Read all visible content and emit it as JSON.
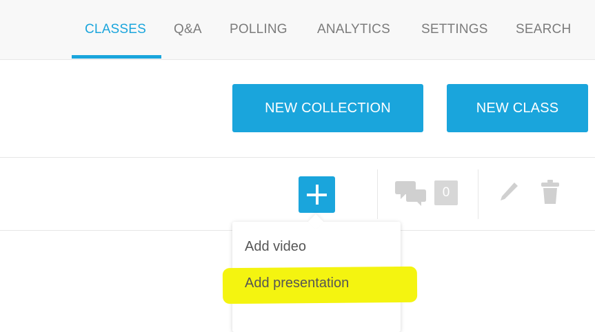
{
  "topnav": {
    "tabs": [
      {
        "label": "CLASSES",
        "active": true
      },
      {
        "label": "Q&A",
        "active": false
      },
      {
        "label": "POLLING",
        "active": false
      },
      {
        "label": "ANALYTICS",
        "active": false
      },
      {
        "label": "SETTINGS",
        "active": false
      },
      {
        "label": "SEARCH",
        "active": false
      }
    ]
  },
  "actions": {
    "new_collection_label": "NEW COLLECTION",
    "new_class_label": "NEW CLASS"
  },
  "item_toolbar": {
    "add_icon": "plus-icon",
    "comments_icon": "chat-bubbles-icon",
    "comments_count": "0",
    "edit_icon": "pencil-icon",
    "delete_icon": "trash-icon"
  },
  "add_menu": {
    "items": [
      {
        "label": "Add video",
        "highlighted": false
      },
      {
        "label": "Add presentation",
        "highlighted": true
      }
    ]
  },
  "colors": {
    "accent": "#1aa5dc",
    "highlight": "#f4f410",
    "icon_gray": "#d0d0d0"
  }
}
